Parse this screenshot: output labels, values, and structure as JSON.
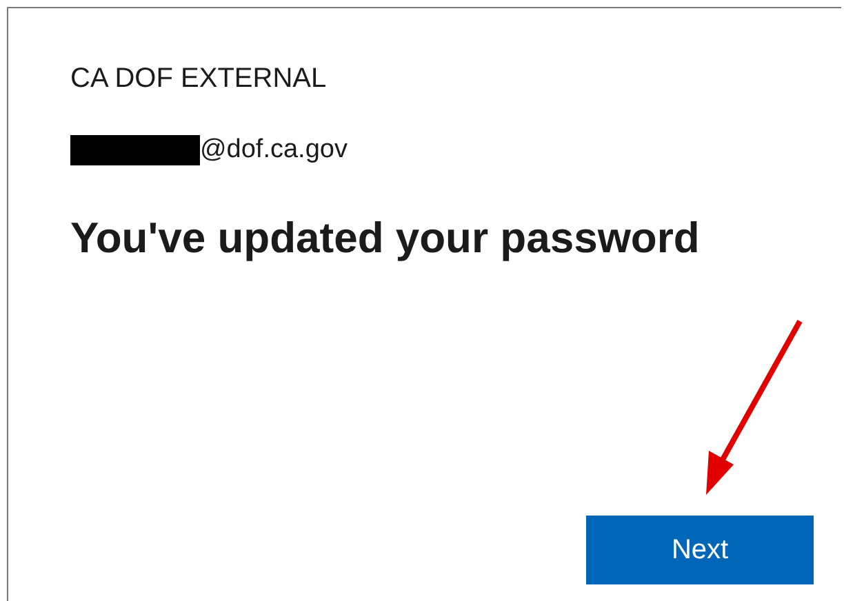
{
  "brand": "CA DOF EXTERNAL",
  "account": {
    "redacted": true,
    "email": "@dof.ca.gov"
  },
  "heading": "You've updated your password",
  "annotation": {
    "kind": "arrow",
    "color": "#e00000"
  },
  "buttons": [
    {
      "label": "Next",
      "kind": "primary"
    }
  ]
}
